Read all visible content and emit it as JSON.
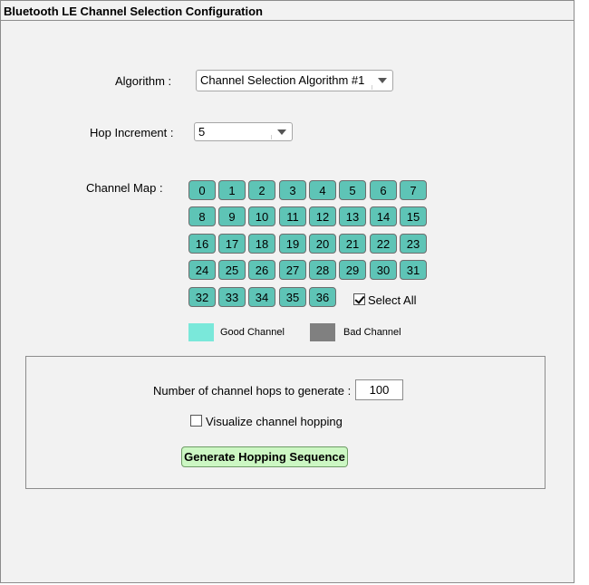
{
  "window": {
    "title": "Bluetooth LE Channel Selection Configuration"
  },
  "algorithm": {
    "label": "Algorithm  :",
    "value": "Channel Selection Algorithm #1"
  },
  "hop_increment": {
    "label": "Hop Increment  :",
    "value": "5"
  },
  "channel_map": {
    "label": "Channel Map  :",
    "channels": [
      "0",
      "1",
      "2",
      "3",
      "4",
      "5",
      "6",
      "7",
      "8",
      "9",
      "10",
      "11",
      "12",
      "13",
      "14",
      "15",
      "16",
      "17",
      "18",
      "19",
      "20",
      "21",
      "22",
      "23",
      "24",
      "25",
      "26",
      "27",
      "28",
      "29",
      "30",
      "31",
      "32",
      "33",
      "34",
      "35",
      "36"
    ],
    "select_all_label": "Select All",
    "select_all_checked": true
  },
  "legend": {
    "good_label": "Good Channel",
    "bad_label": "Bad Channel",
    "good_color": "#7ae8da",
    "bad_color": "#808080"
  },
  "hops": {
    "label": "Number of channel hops to generate :",
    "value": "100"
  },
  "visualize": {
    "label": "Visualize channel hopping",
    "checked": false
  },
  "generate_button": {
    "label": "Generate Hopping Sequence"
  }
}
